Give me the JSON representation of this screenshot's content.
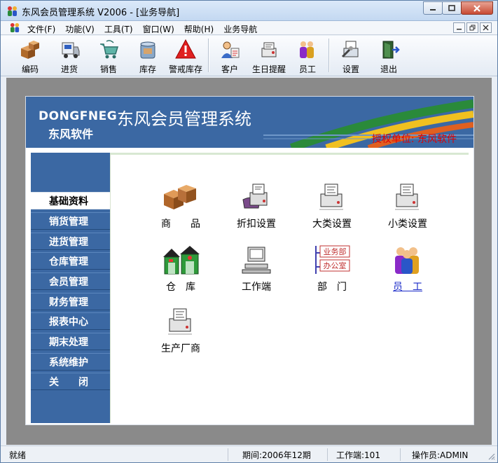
{
  "window": {
    "title": "东风会员管理系统 V2006 - [业务导航]"
  },
  "menu": {
    "items": [
      "文件(F)",
      "功能(V)",
      "工具(T)",
      "窗口(W)",
      "帮助(H)",
      "业务导航"
    ]
  },
  "toolbar": {
    "buttons": [
      {
        "label": "编码",
        "icon": "boxes-icon"
      },
      {
        "label": "进货",
        "icon": "truck-icon"
      },
      {
        "label": "销售",
        "icon": "cart-icon"
      },
      {
        "label": "库存",
        "icon": "cans-icon"
      },
      {
        "label": "警戒库存",
        "icon": "warning-icon"
      },
      {
        "label": "客户",
        "icon": "customer-icon"
      },
      {
        "label": "生日提醒",
        "icon": "birthday-icon"
      },
      {
        "label": "员工",
        "icon": "staff-icon"
      },
      {
        "label": "设置",
        "icon": "settings-icon"
      },
      {
        "label": "退出",
        "icon": "exit-door-icon"
      }
    ]
  },
  "banner": {
    "brand_en": "DONGFNEG",
    "brand_cn": "东风软件",
    "app_title": "东风会员管理系统",
    "licensee": "授权单位: 东风软件"
  },
  "sidebar": {
    "items": [
      "基础资料",
      "销货管理",
      "进货管理",
      "仓库管理",
      "会员管理",
      "财务管理",
      "报表中心",
      "期末处理",
      "系统维护",
      "关　　闭"
    ],
    "active_index": 0
  },
  "tiles": [
    {
      "label": "商　　品",
      "icon": "goods-boxes-icon"
    },
    {
      "label": "折扣设置",
      "icon": "discount-printer-icon"
    },
    {
      "label": "大类设置",
      "icon": "major-category-printer-icon"
    },
    {
      "label": "小类设置",
      "icon": "minor-category-printer-icon"
    },
    {
      "label": "仓　库",
      "icon": "warehouse-icon"
    },
    {
      "label": "工作端",
      "icon": "workstation-computer-icon"
    },
    {
      "label": "部　门",
      "icon": "department-icon",
      "dept_labels": [
        "业务部",
        "办公室"
      ]
    },
    {
      "label": "员　工",
      "icon": "employees-icon"
    },
    {
      "label": "生产厂商",
      "icon": "manufacturer-printer-icon"
    }
  ],
  "statusbar": {
    "status": "就绪",
    "period": "期间:2006年12期",
    "workstation": "工作端:101",
    "operator": "操作员:ADMIN"
  },
  "colors": {
    "banner_blue": "#3b68a3",
    "licensee_red": "#e00000",
    "workspace_gray": "#8a8a8a"
  }
}
